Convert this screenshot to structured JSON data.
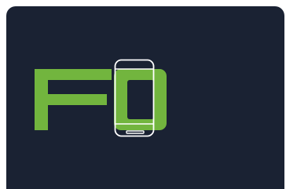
{
  "logo": {
    "name": "FO",
    "accent_color": "#72b53e",
    "device_outline_color": "#ffffff",
    "background_color": "#1a2233",
    "page_background": "#ffffff",
    "icon": "smartphone-outline-icon"
  }
}
